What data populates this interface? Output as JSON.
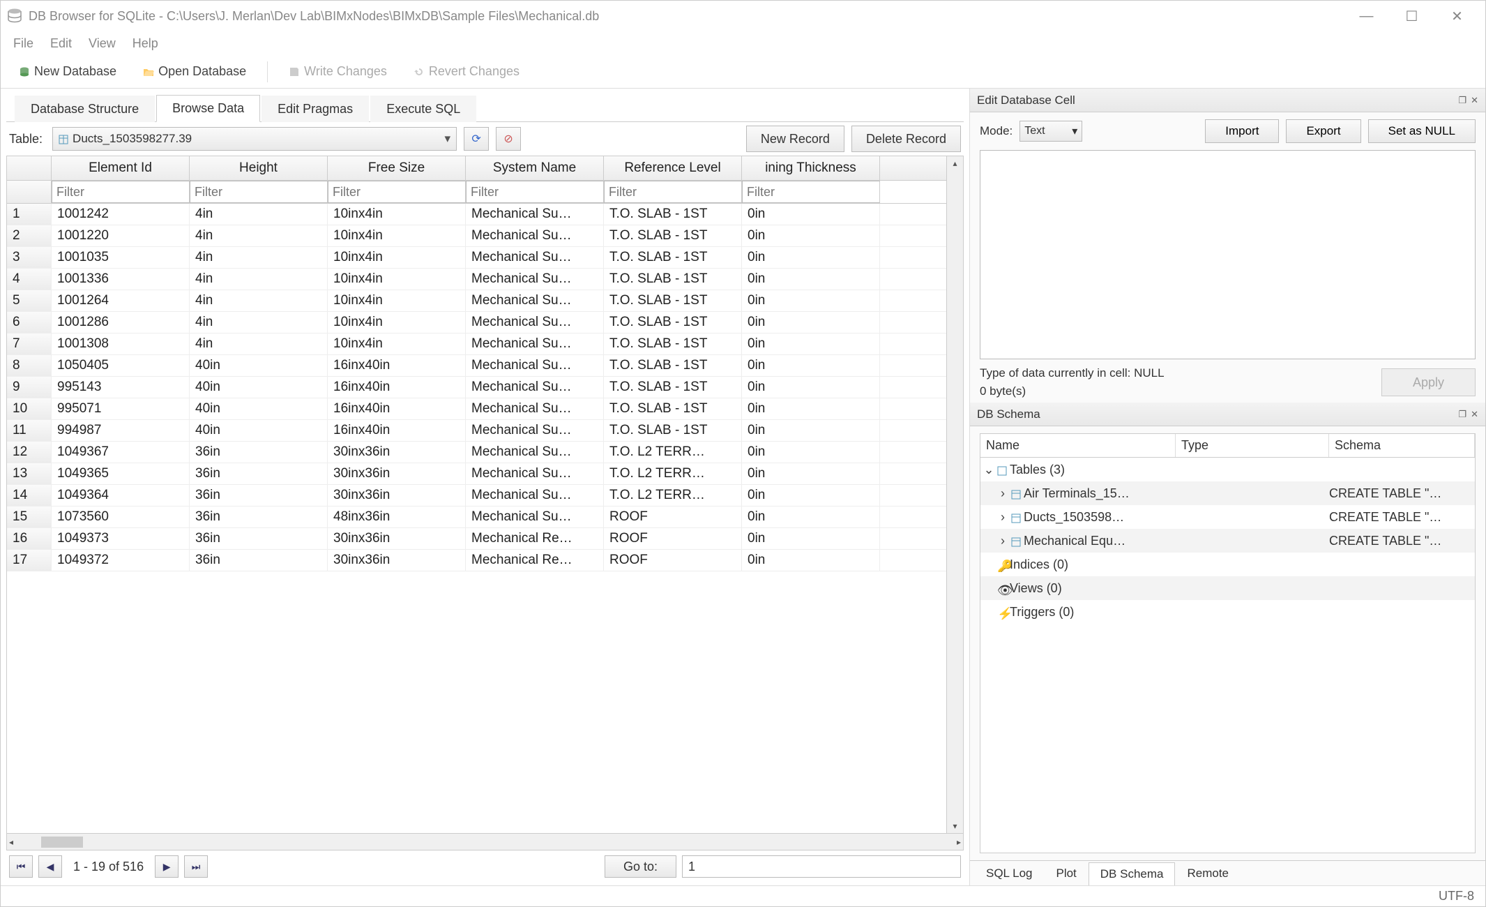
{
  "window": {
    "title": "DB Browser for SQLite - C:\\Users\\J. Merlan\\Dev Lab\\BIMxNodes\\BIMxDB\\Sample Files\\Mechanical.db"
  },
  "menu": {
    "items": [
      "File",
      "Edit",
      "View",
      "Help"
    ]
  },
  "toolbar": {
    "new_db": "New Database",
    "open_db": "Open Database",
    "write_changes": "Write Changes",
    "revert_changes": "Revert Changes"
  },
  "tabs": {
    "items": [
      "Database Structure",
      "Browse Data",
      "Edit Pragmas",
      "Execute SQL"
    ],
    "active_index": 1
  },
  "table_selector": {
    "label": "Table:",
    "value": "Ducts_1503598277.39",
    "new_record": "New Record",
    "delete_record": "Delete Record"
  },
  "grid": {
    "columns": [
      "Element Id",
      "Height",
      "Free Size",
      "System Name",
      "Reference Level",
      "Lining Thickness"
    ],
    "header_display": [
      "Element Id",
      "Height",
      "Free Size",
      "System Name",
      "Reference Level",
      "ining Thickness"
    ],
    "filter_placeholder": "Filter",
    "rows": [
      [
        "1001242",
        "4in",
        "10inx4in",
        "Mechanical Su…",
        "T.O. SLAB - 1ST",
        "0in"
      ],
      [
        "1001220",
        "4in",
        "10inx4in",
        "Mechanical Su…",
        "T.O. SLAB - 1ST",
        "0in"
      ],
      [
        "1001035",
        "4in",
        "10inx4in",
        "Mechanical Su…",
        "T.O. SLAB - 1ST",
        "0in"
      ],
      [
        "1001336",
        "4in",
        "10inx4in",
        "Mechanical Su…",
        "T.O. SLAB - 1ST",
        "0in"
      ],
      [
        "1001264",
        "4in",
        "10inx4in",
        "Mechanical Su…",
        "T.O. SLAB - 1ST",
        "0in"
      ],
      [
        "1001286",
        "4in",
        "10inx4in",
        "Mechanical Su…",
        "T.O. SLAB - 1ST",
        "0in"
      ],
      [
        "1001308",
        "4in",
        "10inx4in",
        "Mechanical Su…",
        "T.O. SLAB - 1ST",
        "0in"
      ],
      [
        "1050405",
        "40in",
        "16inx40in",
        "Mechanical Su…",
        "T.O. SLAB - 1ST",
        "0in"
      ],
      [
        "995143",
        "40in",
        "16inx40in",
        "Mechanical Su…",
        "T.O. SLAB - 1ST",
        "0in"
      ],
      [
        "995071",
        "40in",
        "16inx40in",
        "Mechanical Su…",
        "T.O. SLAB - 1ST",
        "0in"
      ],
      [
        "994987",
        "40in",
        "16inx40in",
        "Mechanical Su…",
        "T.O. SLAB - 1ST",
        "0in"
      ],
      [
        "1049367",
        "36in",
        "30inx36in",
        "Mechanical Su…",
        "T.O. L2 TERR…",
        "0in"
      ],
      [
        "1049365",
        "36in",
        "30inx36in",
        "Mechanical Su…",
        "T.O. L2 TERR…",
        "0in"
      ],
      [
        "1049364",
        "36in",
        "30inx36in",
        "Mechanical Su…",
        "T.O. L2 TERR…",
        "0in"
      ],
      [
        "1073560",
        "36in",
        "48inx36in",
        "Mechanical Su…",
        "ROOF",
        "0in"
      ],
      [
        "1049373",
        "36in",
        "30inx36in",
        "Mechanical Re…",
        "ROOF",
        "0in"
      ],
      [
        "1049372",
        "36in",
        "30inx36in",
        "Mechanical Re…",
        "ROOF",
        "0in"
      ]
    ]
  },
  "pager": {
    "info": "1 - 19 of 516",
    "goto_label": "Go to:",
    "goto_value": "1"
  },
  "cell_panel": {
    "title": "Edit Database Cell",
    "mode_label": "Mode:",
    "mode_value": "Text",
    "import": "Import",
    "export": "Export",
    "set_null": "Set as NULL",
    "type_line": "Type of data currently in cell: NULL",
    "size_line": "0 byte(s)",
    "apply": "Apply"
  },
  "schema_panel": {
    "title": "DB Schema",
    "headers": {
      "name": "Name",
      "type": "Type",
      "schema": "Schema"
    },
    "tables_label": "Tables (3)",
    "tables": [
      {
        "name": "Air Terminals_15…",
        "schema": "CREATE TABLE \"…"
      },
      {
        "name": "Ducts_1503598…",
        "schema": "CREATE TABLE \"…"
      },
      {
        "name": "Mechanical Equ…",
        "schema": "CREATE TABLE \"…"
      }
    ],
    "indices": "Indices (0)",
    "views": "Views (0)",
    "triggers": "Triggers (0)"
  },
  "bottom_tabs": {
    "items": [
      "SQL Log",
      "Plot",
      "DB Schema",
      "Remote"
    ],
    "active_index": 2
  },
  "statusbar": {
    "encoding": "UTF-8"
  }
}
